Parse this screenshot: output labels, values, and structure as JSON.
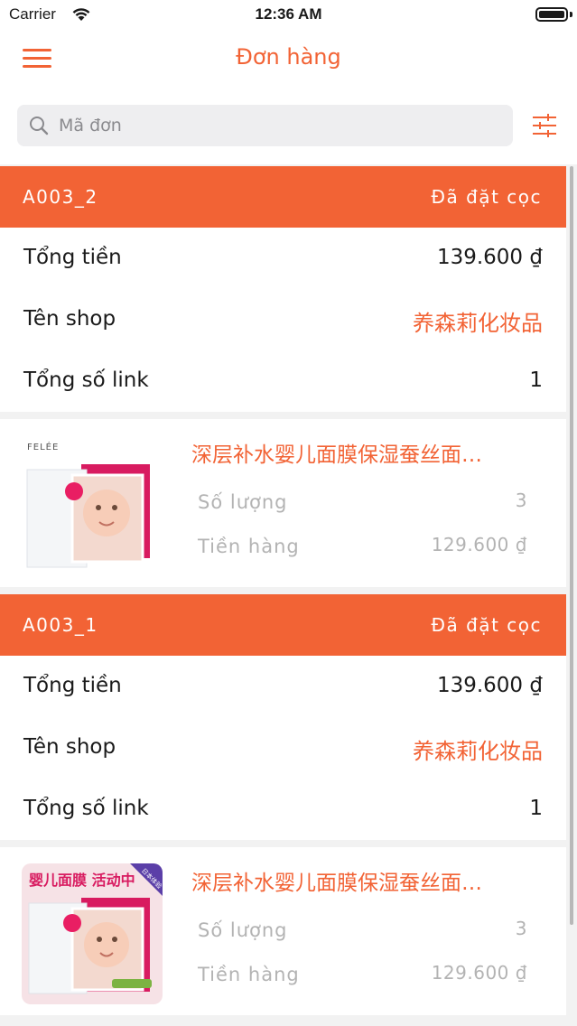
{
  "status_bar": {
    "carrier": "Carrier",
    "time": "12:36 AM"
  },
  "header": {
    "title": "Đơn hàng"
  },
  "search": {
    "placeholder": "Mã đơn"
  },
  "orders": [
    {
      "code": "A003_2",
      "status": "Đã đặt cọc",
      "total_label": "Tổng tiền",
      "total_value": "139.600 ₫",
      "shop_label": "Tên shop",
      "shop_value": "养森莉化妆品",
      "links_label": "Tổng số link",
      "links_value": "1",
      "product": {
        "name": "深层补水婴儿面膜保湿蚕丝面…",
        "quantity_label": "Số lượng",
        "quantity_value": "3",
        "amount_label": "Tiền hàng",
        "amount_value": "129.600 ₫",
        "thumb_brand": "FELÉE"
      }
    },
    {
      "code": "A003_1",
      "status": "Đã đặt cọc",
      "total_label": "Tổng tiền",
      "total_value": "139.600 ₫",
      "shop_label": "Tên shop",
      "shop_value": "养森莉化妆品",
      "links_label": "Tổng số link",
      "links_value": "1",
      "product": {
        "name": "深层补水婴儿面膜保湿蚕丝面…",
        "quantity_label": "Số lượng",
        "quantity_value": "3",
        "amount_label": "Tiền hàng",
        "amount_value": "129.600 ₫",
        "thumb_banner": "婴儿面膜 活动中",
        "thumb_corner": "日本体验"
      }
    }
  ],
  "colors": {
    "accent": "#f26335",
    "background": "#f2f2f2",
    "muted_text": "#b3b3b3"
  },
  "icons": [
    "wifi-icon",
    "battery-icon",
    "menu-icon",
    "search-icon",
    "filter-icon"
  ]
}
